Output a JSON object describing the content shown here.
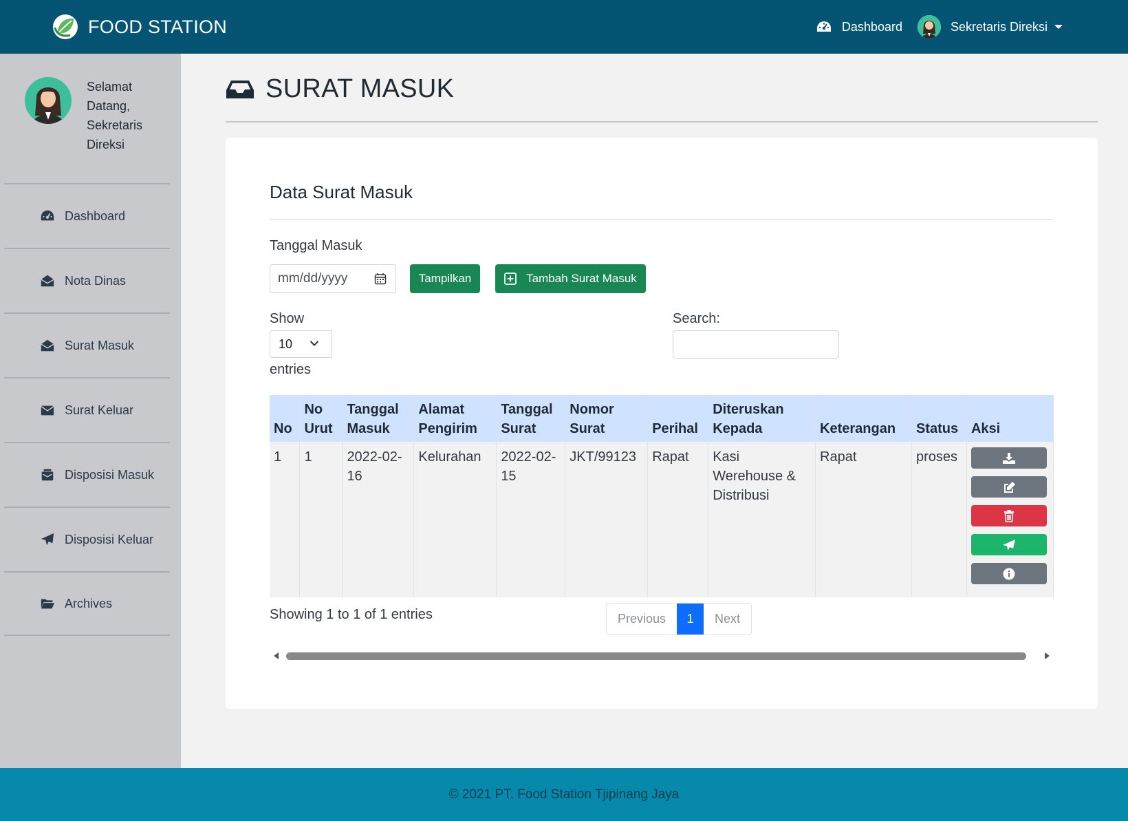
{
  "app": {
    "brand": "FOOD STATION",
    "colors": {
      "navbar": "#055474",
      "footer": "#0689ab",
      "sidebar": "#c8c9cd",
      "primary_green": "#198754",
      "active_page": "#0d6efd",
      "table_header": "#cfe2ff"
    }
  },
  "topbar": {
    "dashboard_label": "Dashboard",
    "user_label": "Sekretaris Direksi"
  },
  "sidebar": {
    "welcome": "Selamat Datang, Sekretaris Direksi",
    "items": [
      {
        "label": "Dashboard",
        "icon": "tachometer-icon"
      },
      {
        "label": "Nota Dinas",
        "icon": "envelope-open-icon"
      },
      {
        "label": "Surat Masuk",
        "icon": "envelope-open-icon"
      },
      {
        "label": "Surat Keluar",
        "icon": "envelope-icon"
      },
      {
        "label": "Disposisi Masuk",
        "icon": "mail-bulk-icon"
      },
      {
        "label": "Disposisi Keluar",
        "icon": "paper-plane-icon"
      },
      {
        "label": "Archives",
        "icon": "folder-open-icon"
      }
    ]
  },
  "main": {
    "page_title": "SURAT MASUK",
    "card_title": "Data Surat Masuk",
    "filter": {
      "date_label": "Tanggal Masuk",
      "date_placeholder": "mm/dd/yyyy",
      "show_button": "Tampilkan",
      "add_button": "Tambah Surat Masuk"
    },
    "table_controls": {
      "show_label": "Show",
      "show_value": "10",
      "entries_label": "entries",
      "search_label": "Search:"
    },
    "table": {
      "headers": [
        "No",
        "No Urut",
        "Tanggal Masuk",
        "Alamat Pengirim",
        "Tanggal Surat",
        "Nomor Surat",
        "Perihal",
        "Diteruskan Kepada",
        "Keterangan",
        "Status",
        "Aksi"
      ],
      "rows": [
        [
          "1",
          "1",
          "2022-02-16",
          "Kelurahan",
          "2022-02-15",
          "JKT/99123",
          "Rapat",
          "Kasi Werehouse & Distribusi",
          "Rapat",
          "proses"
        ]
      ]
    },
    "pagination": {
      "info": "Showing 1 to 1 of 1 entries",
      "previous": "Previous",
      "current": "1",
      "next": "Next"
    }
  },
  "footer": {
    "text": "© 2021 PT. Food Station Tjipinang Jaya"
  }
}
